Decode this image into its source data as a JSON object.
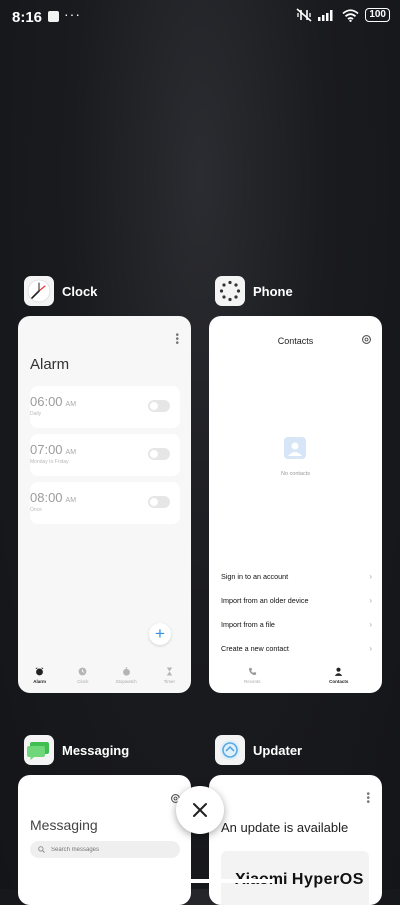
{
  "status_bar": {
    "time": "8:16",
    "dots": "···",
    "battery": "100"
  },
  "apps": {
    "clock": {
      "name": "Clock",
      "screen_title": "Alarm",
      "alarms": [
        {
          "time": "06:00",
          "ampm": "AM",
          "sub": "Daily"
        },
        {
          "time": "07:00",
          "ampm": "AM",
          "sub": "Monday to Friday"
        },
        {
          "time": "08:00",
          "ampm": "AM",
          "sub": "Once"
        }
      ],
      "tabs": [
        {
          "label": "Alarm",
          "icon": "alarm-icon",
          "active": true
        },
        {
          "label": "Clock",
          "icon": "clock-icon",
          "active": false
        },
        {
          "label": "Stopwatch",
          "icon": "stopwatch-icon",
          "active": false
        },
        {
          "label": "Timer",
          "icon": "timer-icon",
          "active": false
        }
      ],
      "fab_symbol": "+"
    },
    "phone": {
      "name": "Phone",
      "screen_title": "Contacts",
      "empty_text": "No contacts",
      "menu": [
        {
          "label": "Sign in to an account"
        },
        {
          "label": "Import from an older device"
        },
        {
          "label": "Import from a file"
        },
        {
          "label": "Create a new contact"
        }
      ],
      "tabs": [
        {
          "label": "Recents",
          "icon": "phone-icon",
          "active": false
        },
        {
          "label": "Contacts",
          "icon": "person-icon",
          "active": true
        }
      ]
    },
    "messaging": {
      "name": "Messaging",
      "screen_title": "Messaging",
      "search_placeholder": "Search messages"
    },
    "updater": {
      "name": "Updater",
      "screen_title": "An update is available",
      "brand_word": "Xiaomi",
      "brand_os": "HyperOS"
    }
  },
  "colors": {
    "accent_blue": "#2f8fe8",
    "message_green": "#3fbf4f"
  }
}
